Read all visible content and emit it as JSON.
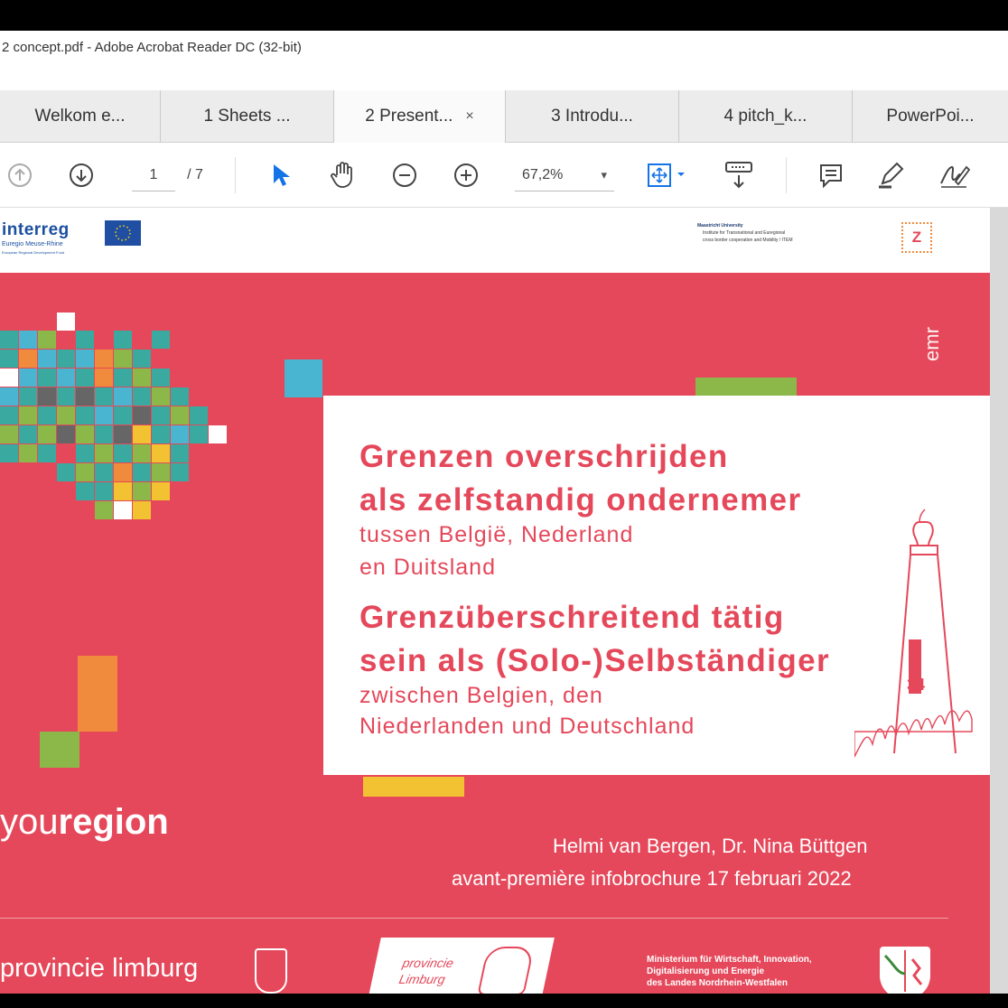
{
  "window": {
    "title": "2 concept.pdf - Adobe Acrobat Reader DC (32-bit)"
  },
  "tabs": [
    {
      "label": "Welkom e..."
    },
    {
      "label": "1 Sheets ..."
    },
    {
      "label": "2 Present...",
      "close": "×"
    },
    {
      "label": "3 Introdu..."
    },
    {
      "label": "4 pitch_k..."
    },
    {
      "label": "PowerPoi..."
    }
  ],
  "toolbar": {
    "page_current": "1",
    "page_total": "/ 7",
    "zoom": "67,2%",
    "zoom_arrow": "▾"
  },
  "slide": {
    "interreg": {
      "name": "interreg",
      "sub1": "Euregio Meuse-Rhine",
      "sub2": "European Regional Development Fund"
    },
    "um_logo": {
      "line1": "Maastricht University",
      "line2": "Institute for Transnational and Euregional",
      "line3": "cross border cooperation and Mobility / ITEM"
    },
    "z_mark": "Z",
    "emr": "emr",
    "title_nl": [
      "Grenzen overschrijden",
      "als zelfstandig ondernemer"
    ],
    "subtitle_nl": [
      "tussen België, Nederland",
      "en Duitsland"
    ],
    "title_de": [
      "Grenzüberschreitend tätig",
      "sein als (Solo-)Selbständiger"
    ],
    "subtitle_de": [
      "zwischen Belgien, den",
      "Niederlanden und Deutschland"
    ],
    "stone_number": "34",
    "youregion_you": "you",
    "youregion_region": "region",
    "authors": "Helmi van Bergen, Dr. Nina Büttgen",
    "event": "avant-première infobrochure 17 februari 2022",
    "footer": {
      "provincie": "provincie limburg",
      "provincie_nl": [
        "provincie",
        "Limburg"
      ],
      "ministry": [
        "Ministerium für Wirtschaft, Innovation,",
        "Digitalisierung und Energie",
        "des Landes Nordrhein-Westfalen"
      ]
    }
  },
  "colors": {
    "slide_red": "#e5485a",
    "teal": "#3aa9a0",
    "blue": "#4ab5d0",
    "green": "#8cb84a",
    "orange": "#f08a3c",
    "yellow": "#f2c232",
    "acrobat_blue": "#1473e6"
  }
}
